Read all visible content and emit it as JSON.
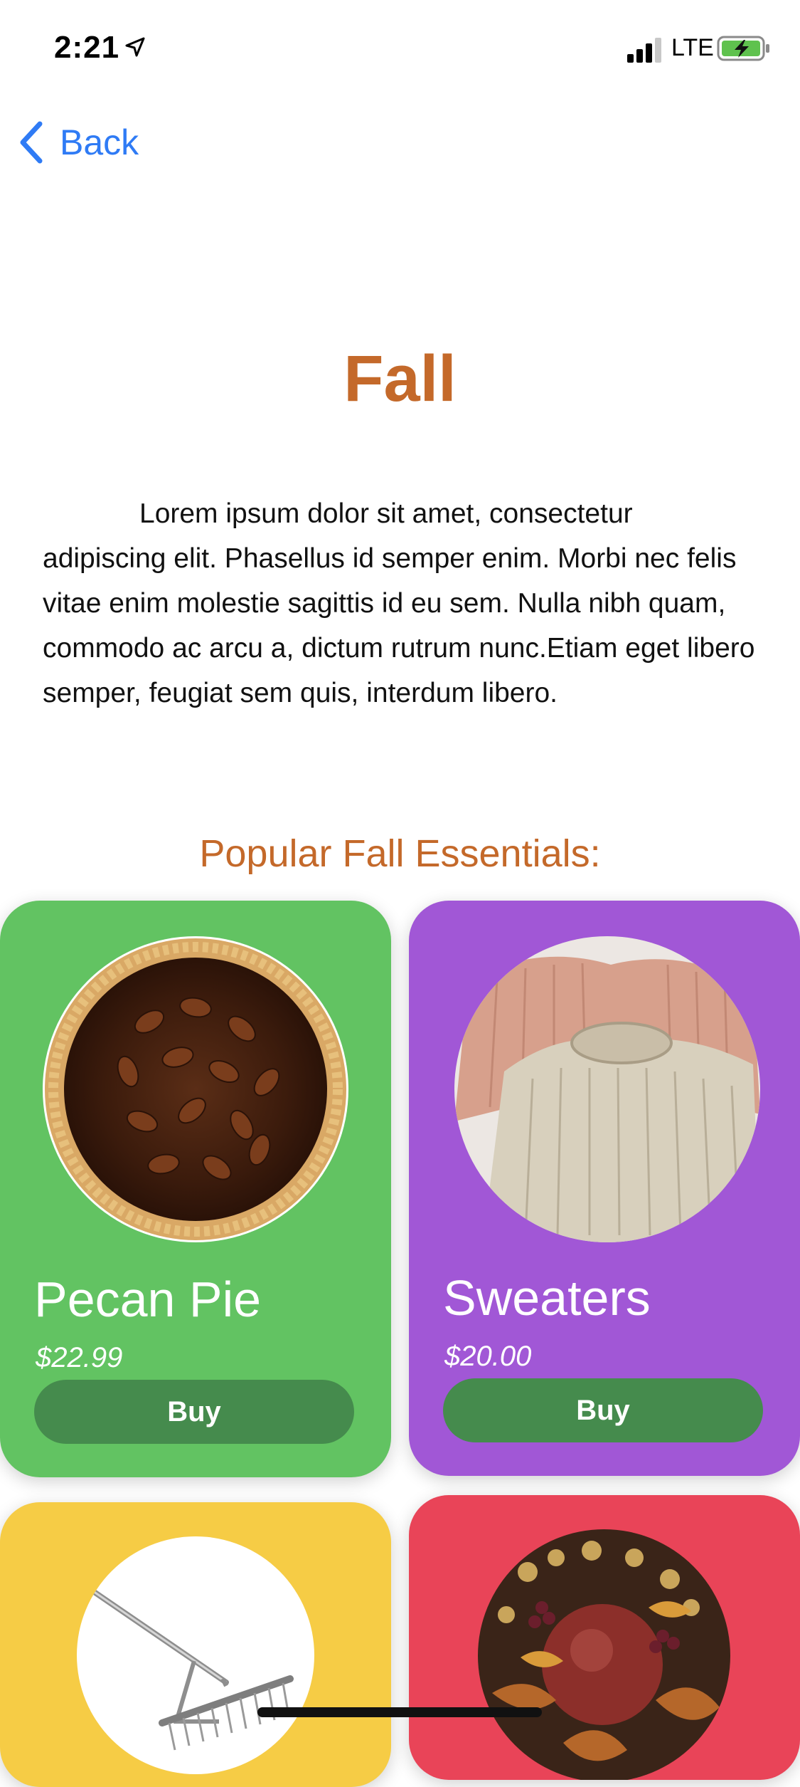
{
  "status_bar": {
    "time": "2:21",
    "network": "LTE",
    "icons": [
      "location-arrow-icon",
      "cellular-signal-icon",
      "battery-charging-icon"
    ]
  },
  "nav": {
    "back_label": "Back",
    "back_icon": "chevron-left-icon"
  },
  "page": {
    "title": "Fall",
    "description": "Lorem ipsum dolor sit amet, consectetur adipiscing elit. Phasellus id semper enim. Morbi nec felis vitae enim molestie sagittis id eu sem. Nulla nibh quam, commodo ac arcu a, dictum rutrum nunc.Etiam eget libero semper, feugiat sem quis, interdum libero.",
    "section_heading": "Popular Fall Essentials:"
  },
  "products": [
    {
      "name": "Pecan Pie",
      "price": "$22.99",
      "buy_label": "Buy",
      "color": "#62c362",
      "image": "pecan-pie-image"
    },
    {
      "name": "Sweaters",
      "price": "$20.00",
      "buy_label": "Buy",
      "color": "#a157d6",
      "image": "sweaters-image"
    },
    {
      "image": "rake-image",
      "color": "#f6cc45"
    },
    {
      "image": "fall-decor-image",
      "color": "#e94458"
    }
  ],
  "colors": {
    "accent": "#c4692a",
    "link": "#2f7bf5",
    "button": "#458b4d"
  }
}
